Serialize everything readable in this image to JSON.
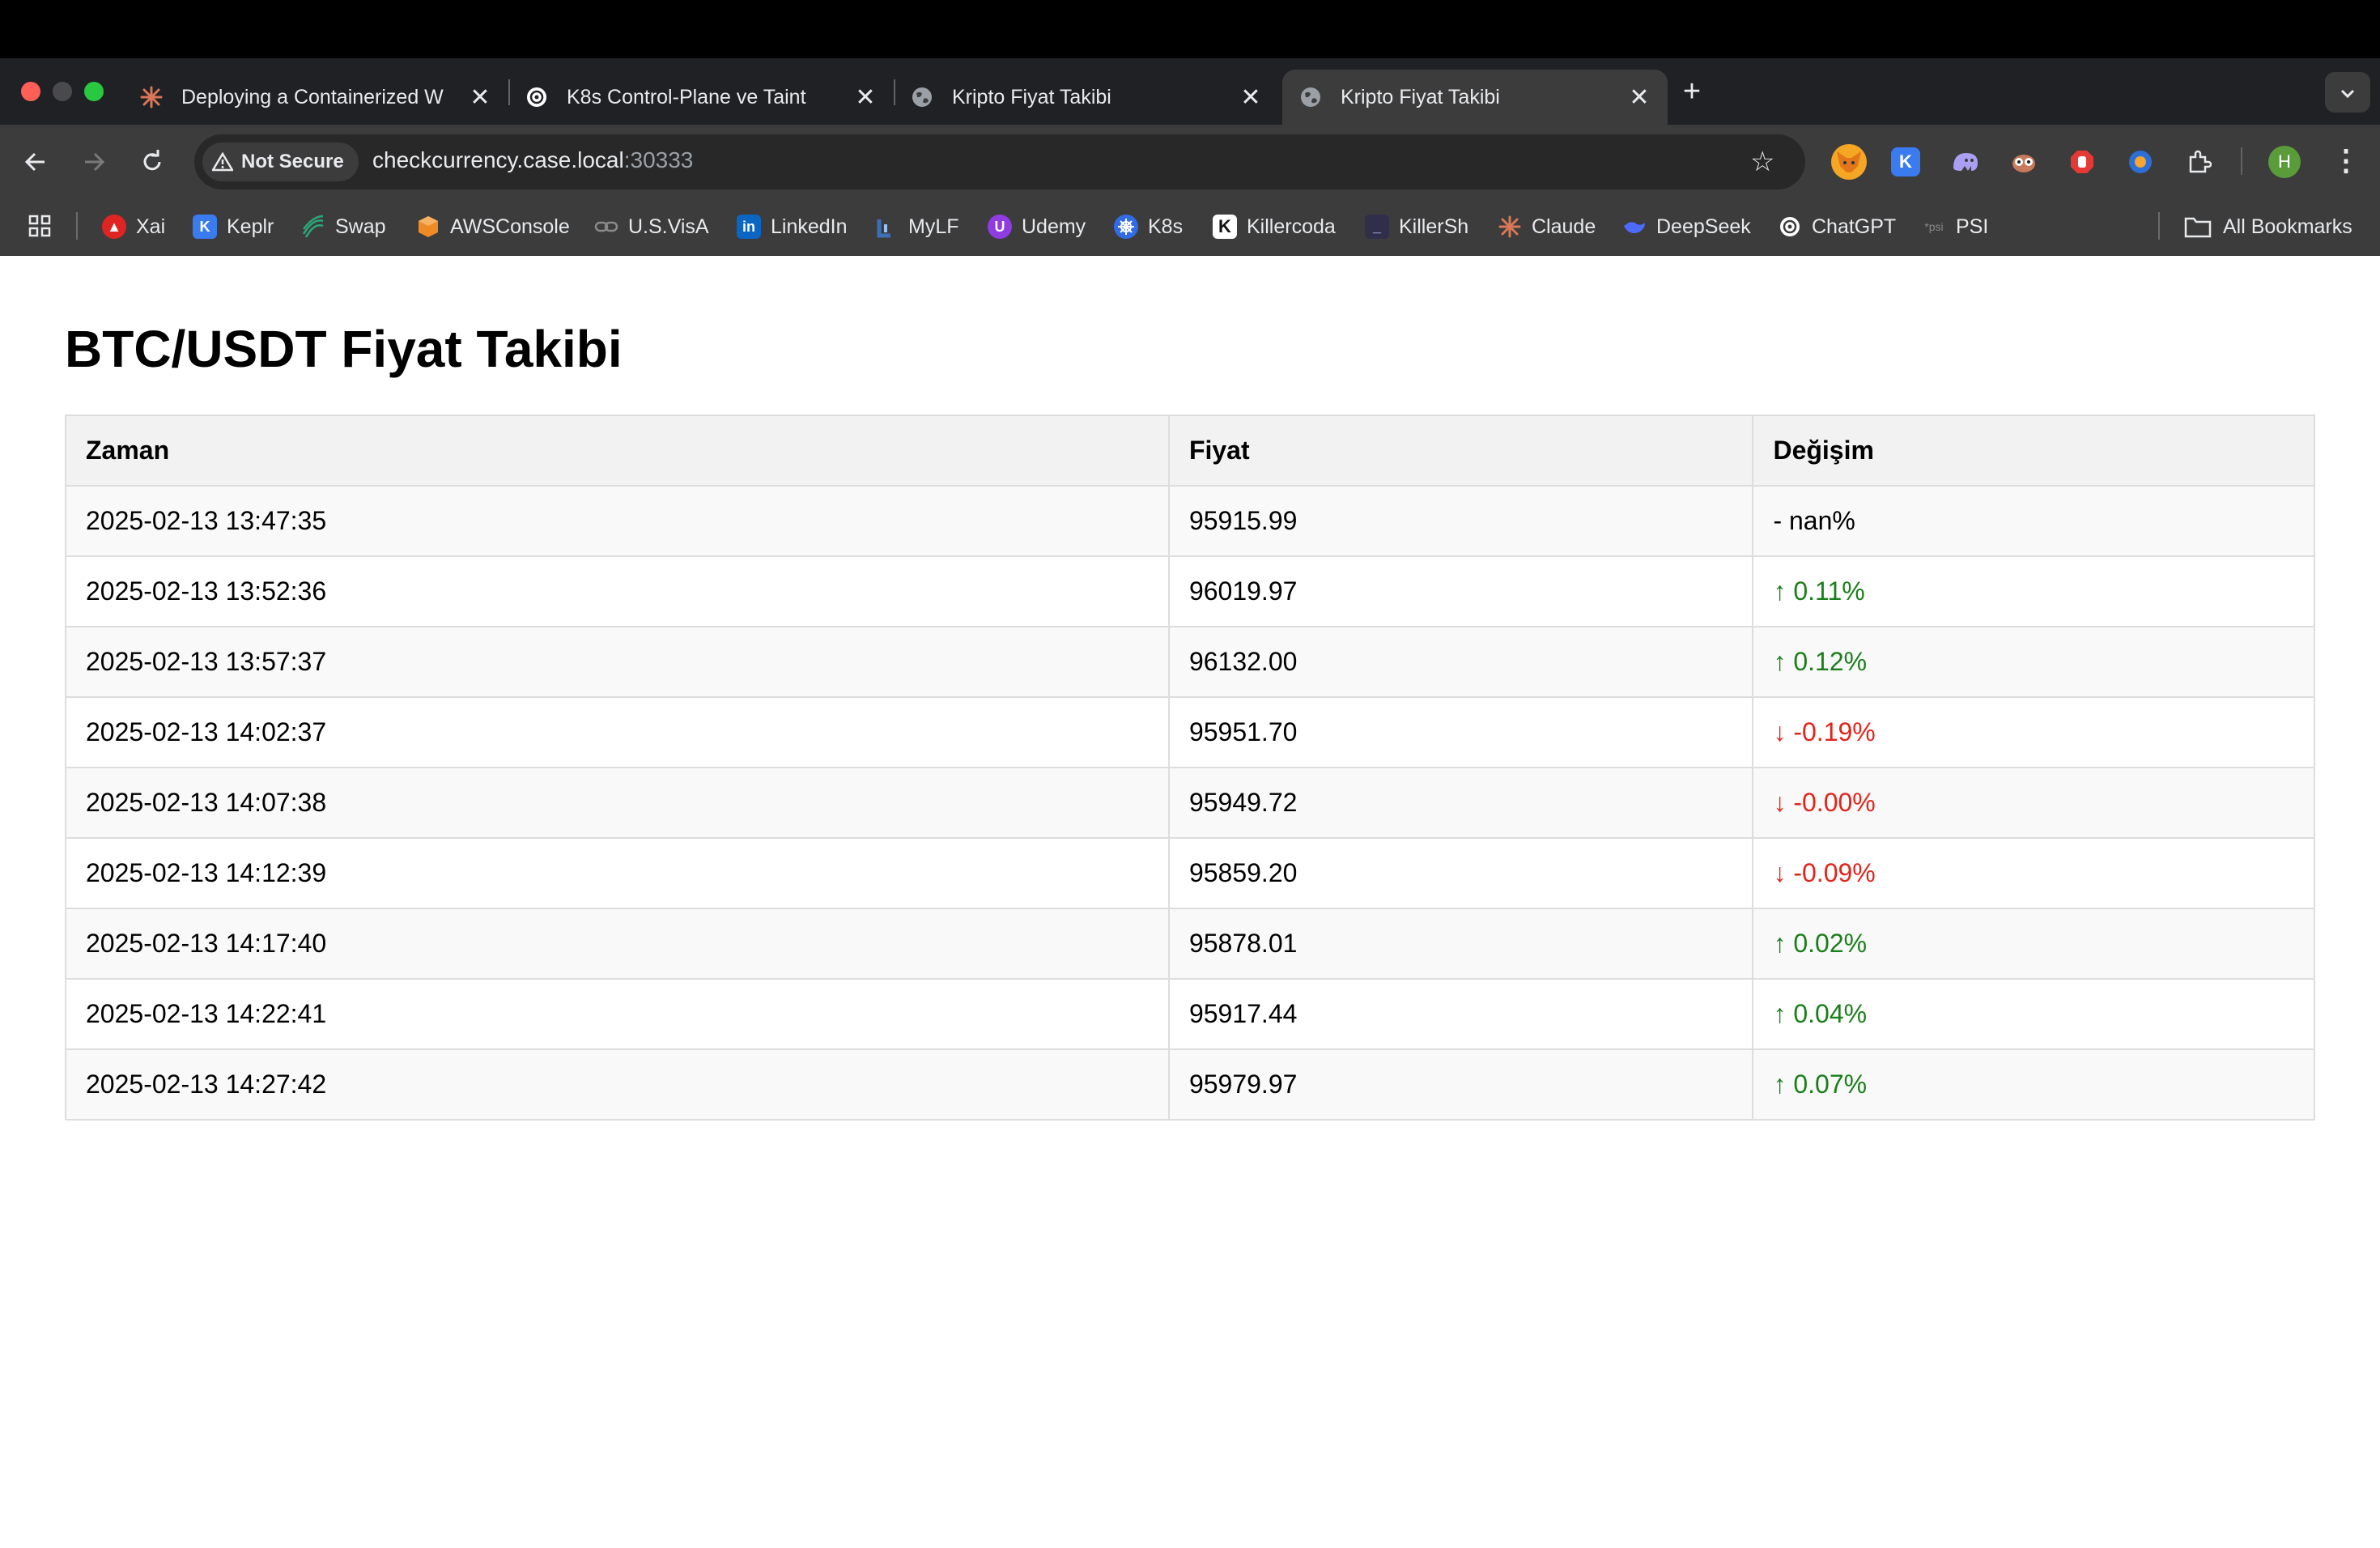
{
  "browser": {
    "tabs": [
      {
        "title": "Deploying a Containerized W",
        "favicon": "claude-icon",
        "active": false
      },
      {
        "title": "K8s Control-Plane ve Taint",
        "favicon": "chatgpt-icon",
        "active": false
      },
      {
        "title": "Kripto Fiyat Takibi",
        "favicon": "globe-icon",
        "active": false
      },
      {
        "title": "Kripto Fiyat Takibi",
        "favicon": "globe-icon",
        "active": true
      }
    ],
    "new_tab": "+",
    "close_glyph": "✕",
    "security_label": "Not Secure",
    "url_host": "checkcurrency.case.local",
    "url_rest": ":30333",
    "profile_initial": "H",
    "bookmarks": [
      {
        "label": "Xai",
        "icon": "xai-icon",
        "color": "#e02424"
      },
      {
        "label": "Keplr",
        "icon": "keplr-icon",
        "color": "#3a7bf0"
      },
      {
        "label": "Swap",
        "icon": "swap-icon",
        "color": "#2aa87a"
      },
      {
        "label": "AWSConsole",
        "icon": "aws-icon",
        "color": "#f08a24"
      },
      {
        "label": "U.S.VisA",
        "icon": "link-icon",
        "color": "#777777"
      },
      {
        "label": "LinkedIn",
        "icon": "linkedin-icon",
        "color": "#0a66c2"
      },
      {
        "label": "MyLF",
        "icon": "mylf-icon",
        "color": "#3d6fb6"
      },
      {
        "label": "Udemy",
        "icon": "udemy-icon",
        "color": "#8f3ce0"
      },
      {
        "label": "K8s",
        "icon": "kubernetes-icon",
        "color": "#326ce5"
      },
      {
        "label": "Killercoda",
        "icon": "killercoda-icon",
        "color": "#111111"
      },
      {
        "label": "KillerSh",
        "icon": "killersh-icon",
        "color": "#2f2f4a"
      },
      {
        "label": "Claude",
        "icon": "claude-icon",
        "color": "#d97757"
      },
      {
        "label": "DeepSeek",
        "icon": "deepseek-icon",
        "color": "#4d6bfe"
      },
      {
        "label": "ChatGPT",
        "icon": "chatgpt-icon",
        "color": "#444444"
      },
      {
        "label": "PSI",
        "icon": "psi-icon",
        "color": "#555555"
      }
    ],
    "all_bookmarks": "All Bookmarks"
  },
  "page": {
    "title": "BTC/USDT Fiyat Takibi",
    "columns": [
      "Zaman",
      "Fiyat",
      "Değişim"
    ],
    "rows": [
      {
        "time": "2025-02-13 13:47:35",
        "price": "95915.99",
        "change": "- nan%",
        "direction": "neutral"
      },
      {
        "time": "2025-02-13 13:52:36",
        "price": "96019.97",
        "change": "↑ 0.11%",
        "direction": "up"
      },
      {
        "time": "2025-02-13 13:57:37",
        "price": "96132.00",
        "change": "↑ 0.12%",
        "direction": "up"
      },
      {
        "time": "2025-02-13 14:02:37",
        "price": "95951.70",
        "change": "↓ -0.19%",
        "direction": "down"
      },
      {
        "time": "2025-02-13 14:07:38",
        "price": "95949.72",
        "change": "↓ -0.00%",
        "direction": "down"
      },
      {
        "time": "2025-02-13 14:12:39",
        "price": "95859.20",
        "change": "↓ -0.09%",
        "direction": "down"
      },
      {
        "time": "2025-02-13 14:17:40",
        "price": "95878.01",
        "change": "↑ 0.02%",
        "direction": "up"
      },
      {
        "time": "2025-02-13 14:22:41",
        "price": "95917.44",
        "change": "↑ 0.04%",
        "direction": "up"
      },
      {
        "time": "2025-02-13 14:27:42",
        "price": "95979.97",
        "change": "↑ 0.07%",
        "direction": "up"
      }
    ]
  },
  "colors": {
    "up": "#1a7f1a",
    "down": "#e3241b"
  }
}
